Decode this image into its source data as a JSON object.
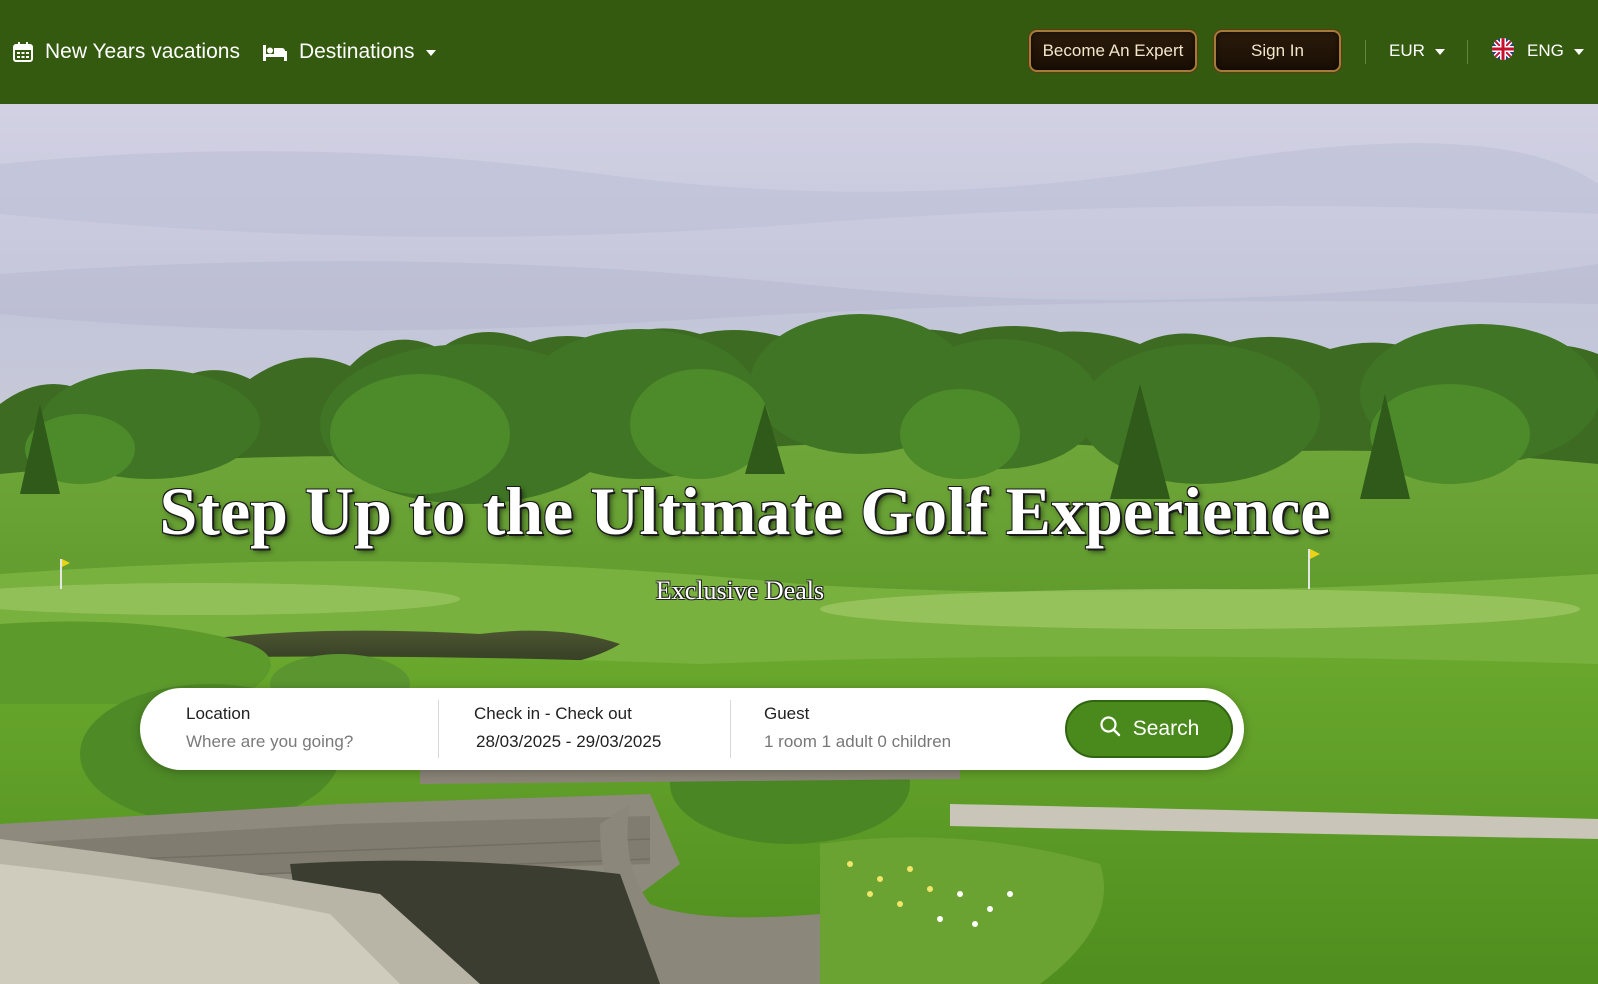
{
  "nav": {
    "vacations_label": "New Years vacations",
    "destinations_label": "Destinations",
    "become_expert_label": "Become An Expert",
    "sign_in_label": "Sign In",
    "currency": "EUR",
    "language": "ENG",
    "icons": {
      "vacations": "calendar-icon",
      "destinations": "bed-icon",
      "language": "uk-flag-icon"
    }
  },
  "hero": {
    "title": "Step Up to the Ultimate Golf Experience",
    "subtitle": "Exclusive Deals"
  },
  "search": {
    "location_label": "Location",
    "location_placeholder": "Where are you going?",
    "location_value": "",
    "dates_label": "Check in - Check out",
    "dates_value": "28/03/2025 - 29/03/2025",
    "guest_label": "Guest",
    "guest_value": "1 room 1 adult 0 children",
    "search_label": "Search"
  },
  "colors": {
    "navbar": "#335a0f",
    "accent_green": "#4a8a1c",
    "dark_button": "#1e1207",
    "gold_border": "#a57b3a"
  }
}
